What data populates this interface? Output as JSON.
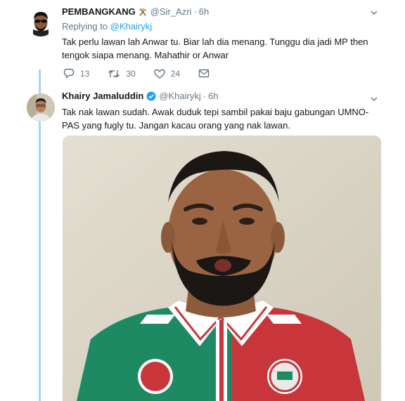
{
  "tweets": [
    {
      "name": "PEMBANGKANG",
      "handle": "@Sir_Azri",
      "separator": "·",
      "time": "6h",
      "replying_prefix": "Replying to",
      "replying_to": "@Khairykj",
      "text": "Tak perlu lawan lah Anwar tu. Biar lah dia menang. Tunggu dia jadi MP then tengok siapa menang. Mahathir or Anwar",
      "replies": "13",
      "retweets": "30",
      "likes": "24"
    },
    {
      "name": "Khairy Jamaluddin",
      "handle": "@Khairykj",
      "separator": "·",
      "time": "6h",
      "text": "Tak nak lawan sudah. Awak duduk tepi sambil pakai baju gabungan UMNO-PAS yang fugly tu. Jangan kacau orang yang nak lawan."
    }
  ],
  "icons": {
    "name_emoji": "hammer-pick-icon",
    "verified": "verified-badge-icon",
    "menu": "chevron-down-icon",
    "reply": "reply-icon",
    "retweet": "retweet-icon",
    "like": "heart-icon",
    "dm": "envelope-icon"
  },
  "colors": {
    "link": "#1da1f2",
    "meta": "#657786",
    "thread_line": "#a8d5f2"
  }
}
